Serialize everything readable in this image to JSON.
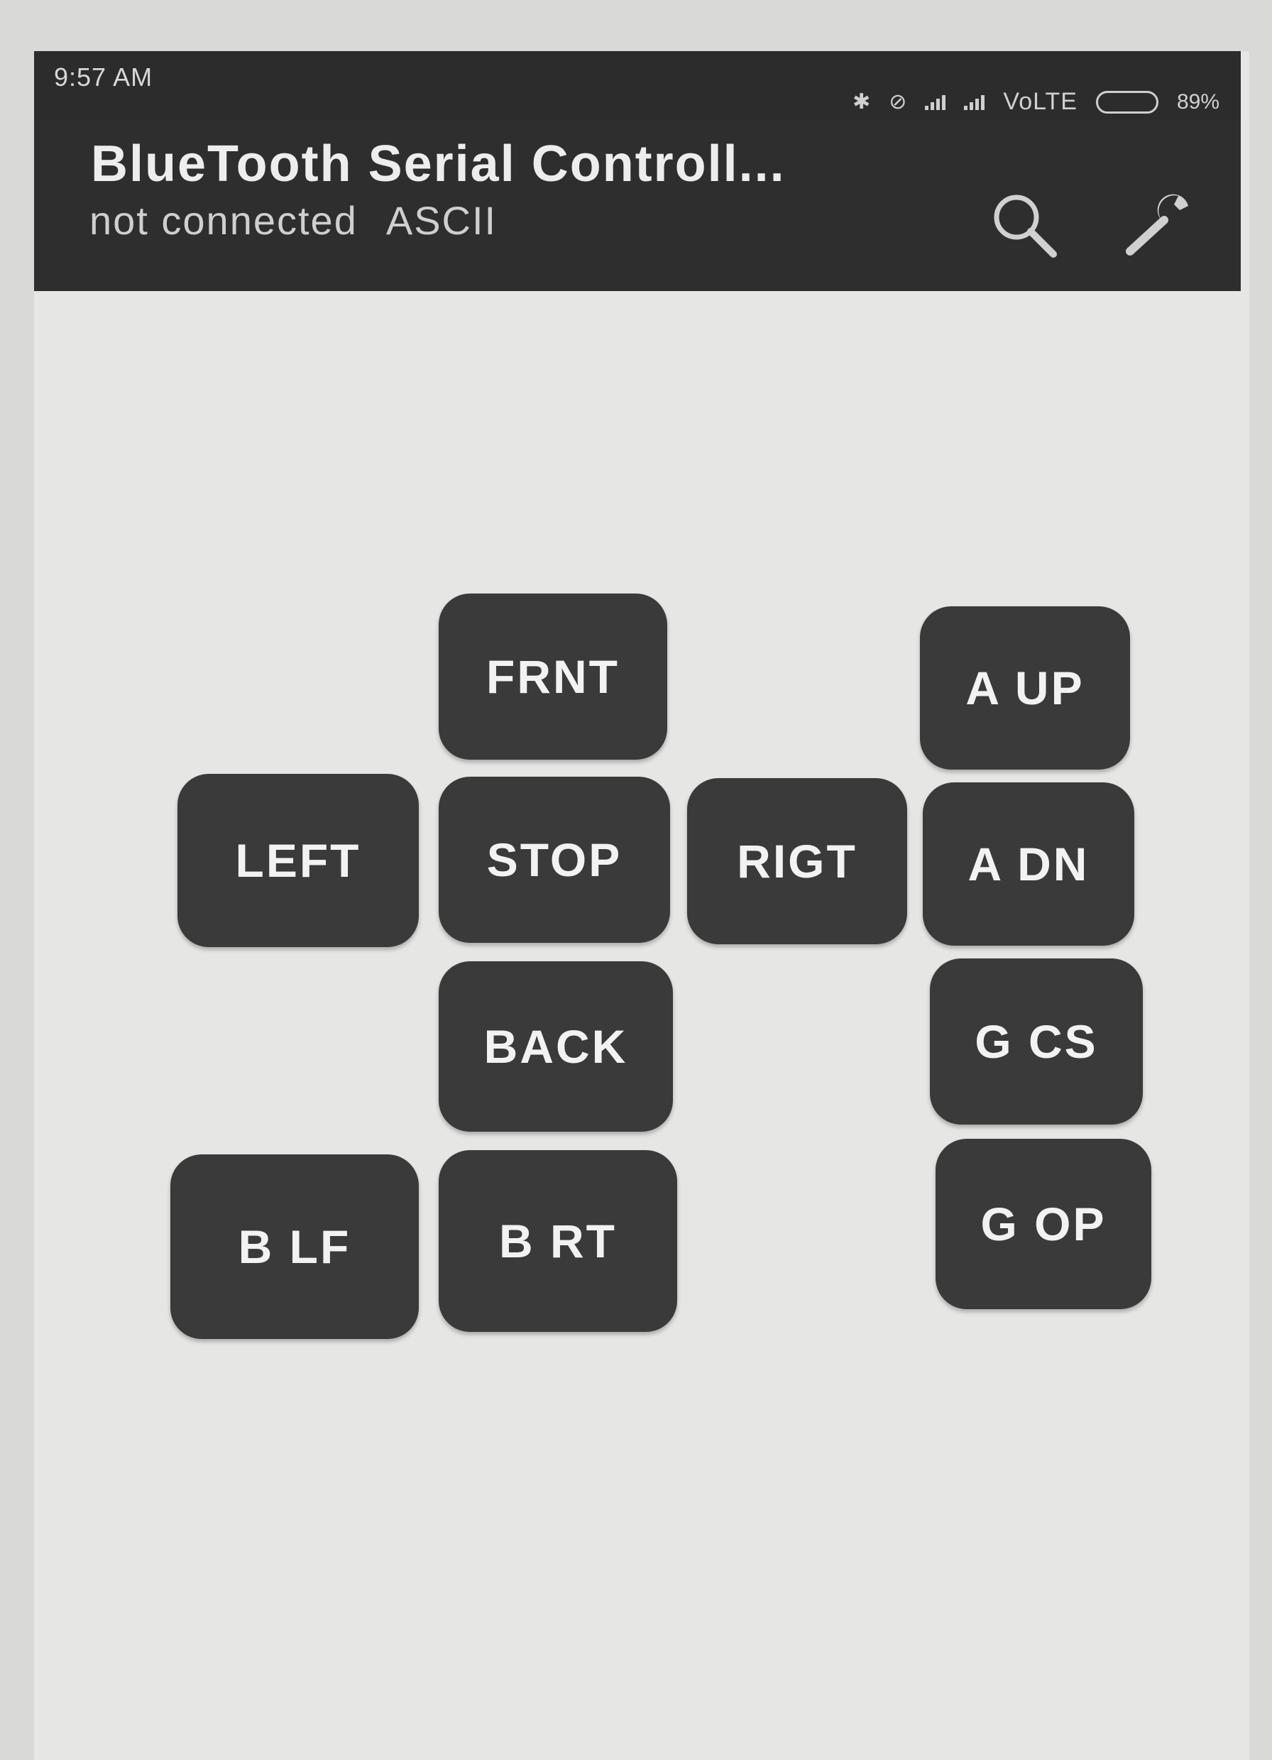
{
  "status_bar": {
    "time": "9:57 AM",
    "network": "VoLTE",
    "battery": "89%",
    "battery_level": 0.89,
    "icons": [
      "bluetooth-icon",
      "no-sim-icon",
      "signal-icon",
      "signal-icon"
    ]
  },
  "action_bar": {
    "title": "BlueTooth Serial Controll...",
    "connection_status": "not connected",
    "mode": "ASCII",
    "icons": [
      "search-icon",
      "wrench-icon"
    ]
  },
  "buttons": {
    "frnt": "FRNT",
    "a_up": "A UP",
    "left": "LEFT",
    "stop": "STOP",
    "rigt": "RIGT",
    "a_dn": "A DN",
    "back": "BACK",
    "g_cs": "G CS",
    "b_lf": "B LF",
    "b_rt": "B RT",
    "g_op": "G OP"
  },
  "colors": {
    "button_bg": "#3a3a3a",
    "bar_bg": "#2c2c2c",
    "page_bg": "#e6e6e4"
  }
}
